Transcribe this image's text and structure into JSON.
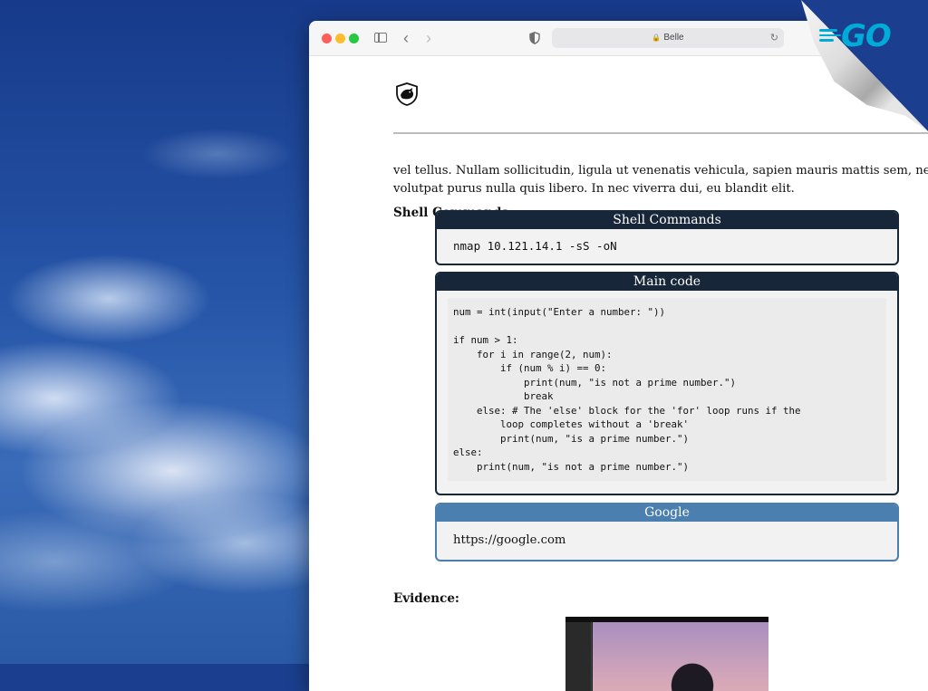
{
  "browser": {
    "address": "Belle"
  },
  "page": {
    "paragraph_line1": "vel tellus.  Nullam sollicitudin, ligula ut venenatis vehicula, sapien mauris mattis sem, nec",
    "paragraph_line2": "volutpat purus nulla quis libero.  In nec viverra dui, eu blandit elit.",
    "shell_heading": "Shell Commands:",
    "evidence_heading": "Evidence:",
    "shell_box": {
      "title": "Shell Commands",
      "command": "nmap 10.121.14.1 -sS -oN"
    },
    "main_box": {
      "title": "Main code",
      "code": "num = int(input(\"Enter a number: \"))\n\nif num > 1:\n    for i in range(2, num):\n        if (num % i) == 0:\n            print(num, \"is not a prime number.\")\n            break\n    else: # The 'else' block for the 'for' loop runs if the\n        loop completes without a 'break'\n        print(num, \"is a prime number.\")\nelse:\n    print(num, \"is not a prime number.\")"
    },
    "google_box": {
      "title": "Google",
      "url": "https://google.com"
    }
  },
  "branding": {
    "go_logo_text": "GO",
    "go_color": "#00acd7"
  },
  "colors": {
    "box_header": "#172639",
    "google_header": "#4a7fb0"
  }
}
